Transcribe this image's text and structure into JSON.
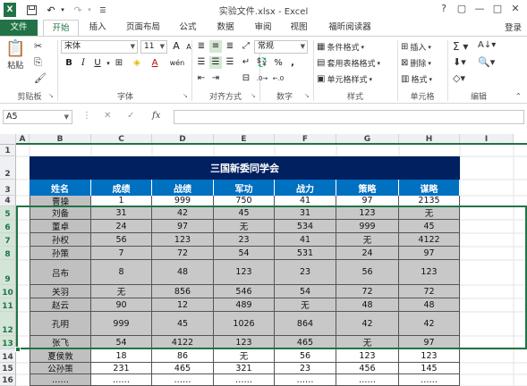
{
  "window": {
    "title": "实验文件.xlsx - Excel",
    "buttons": {
      "help": "?",
      "restore": "▢",
      "minimize": "—",
      "maximize": "□",
      "close": "✕"
    }
  },
  "tabs": [
    {
      "label": "文件",
      "kind": "file"
    },
    {
      "label": "开始",
      "kind": "active"
    },
    {
      "label": "插入"
    },
    {
      "label": "页面布局"
    },
    {
      "label": "公式"
    },
    {
      "label": "数据"
    },
    {
      "label": "审阅"
    },
    {
      "label": "视图"
    },
    {
      "label": "福昕阅读器"
    }
  ],
  "login": "登录",
  "ribbon": {
    "clipboard": {
      "paste": "粘贴",
      "label": "剪贴板"
    },
    "font": {
      "name": "宋体",
      "size": "11",
      "label": "字体",
      "bold": "B",
      "italic": "I",
      "underline": "U",
      "grow": "A",
      "shrink": "A",
      "wen": "wén",
      "font_color": "A"
    },
    "alignment": {
      "label": "对齐方式"
    },
    "number": {
      "format": "常规",
      "label": "数字",
      "percent": "%",
      "comma": ","
    },
    "styles": {
      "conditional": "条件格式",
      "table": "套用表格格式",
      "cell": "单元格样式",
      "label": "样式"
    },
    "cells": {
      "insert": "插入",
      "delete": "删除",
      "format": "格式",
      "label": "单元格"
    },
    "editing": {
      "label": "编辑"
    }
  },
  "formula_bar": {
    "name_box": "A5",
    "cancel": "✕",
    "enter": "✓",
    "fx": "fx",
    "value": ""
  },
  "grid": {
    "columns": [
      "A",
      "B",
      "C",
      "D",
      "E",
      "F",
      "G",
      "H",
      "I"
    ],
    "rows": [
      "1",
      "2",
      "3",
      "4",
      "5",
      "6",
      "7",
      "8",
      "9",
      "10",
      "11",
      "12",
      "13",
      "14",
      "15",
      "16"
    ],
    "title": "三国新委同学会",
    "headers": [
      "姓名",
      "成绩",
      "战绩",
      "军功",
      "战力",
      "策略",
      "谋略"
    ],
    "data": [
      [
        "曹操",
        "1",
        "999",
        "750",
        "41",
        "97",
        "2135"
      ],
      [
        "刘备",
        "31",
        "42",
        "45",
        "31",
        "123",
        "无"
      ],
      [
        "董卓",
        "24",
        "97",
        "无",
        "534",
        "999",
        "45"
      ],
      [
        "孙权",
        "56",
        "123",
        "23",
        "41",
        "无",
        "4122"
      ],
      [
        "孙策",
        "7",
        "72",
        "54",
        "531",
        "24",
        "97"
      ],
      [
        "吕布",
        "8",
        "48",
        "123",
        "23",
        "56",
        "123"
      ],
      [
        "关羽",
        "无",
        "856",
        "546",
        "54",
        "72",
        "72"
      ],
      [
        "赵云",
        "90",
        "12",
        "489",
        "无",
        "48",
        "48"
      ],
      [
        "孔明",
        "999",
        "45",
        "1026",
        "864",
        "42",
        "42"
      ],
      [
        "张飞",
        "54",
        "4122",
        "123",
        "465",
        "无",
        "97"
      ],
      [
        "夏侯敦",
        "18",
        "86",
        "无",
        "56",
        "123",
        "123"
      ],
      [
        "公孙策",
        "231",
        "465",
        "321",
        "23",
        "456",
        "145"
      ],
      [
        "……",
        "……",
        "……",
        "……",
        "……",
        "……",
        "……"
      ]
    ]
  },
  "colors": {
    "excel_green": "#217346",
    "title_bg": "#002060",
    "header_bg": "#0070c0",
    "name_col_bg": "#c0c0c0",
    "selected_bg": "#c8c8c8",
    "selection_outline": "#217346"
  }
}
